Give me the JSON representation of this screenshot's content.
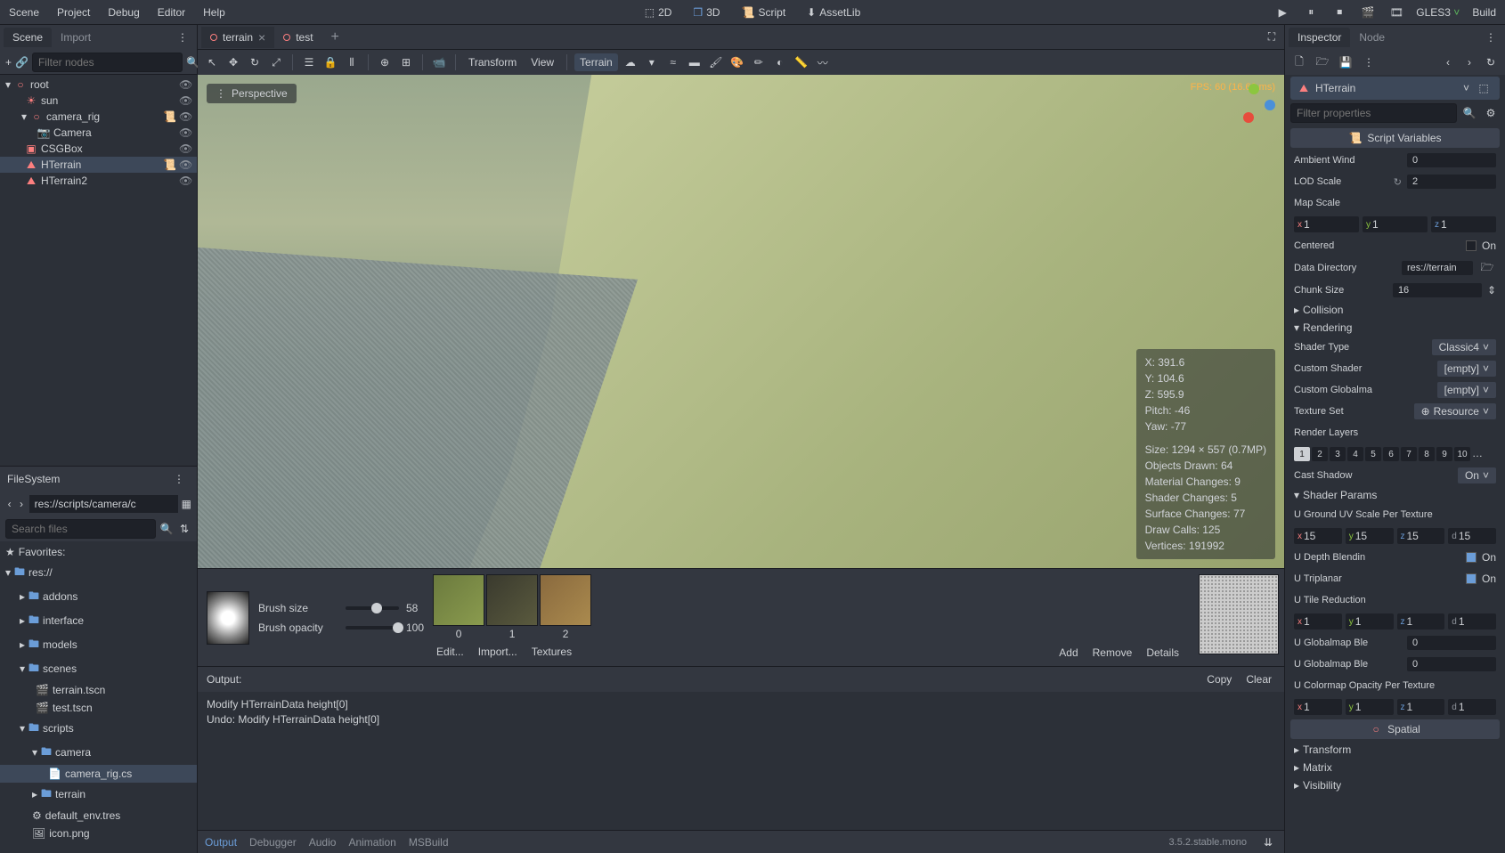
{
  "top_menu": {
    "items": [
      "Scene",
      "Project",
      "Debug",
      "Editor",
      "Help"
    ]
  },
  "top_center": {
    "d2": "2D",
    "d3": "3D",
    "script": "Script",
    "assetlib": "AssetLib"
  },
  "top_right": {
    "renderer": "GLES3",
    "build": "Build"
  },
  "scene_panel": {
    "tabs": {
      "scene": "Scene",
      "import": "Import"
    },
    "filter_placeholder": "Filter nodes",
    "nodes": {
      "root": "root",
      "sun": "sun",
      "camera_rig": "camera_rig",
      "camera": "Camera",
      "csgbox": "CSGBox",
      "hterrain": "HTerrain",
      "hterrain2": "HTerrain2"
    }
  },
  "filesystem": {
    "title": "FileSystem",
    "path": "res://scripts/camera/c",
    "search_placeholder": "Search files",
    "favorites": "Favorites:",
    "items": {
      "res": "res://",
      "addons": "addons",
      "interface": "interface",
      "models": "models",
      "scenes": "scenes",
      "terrain_tscn": "terrain.tscn",
      "test_tscn": "test.tscn",
      "scripts": "scripts",
      "camera": "camera",
      "camera_rig_cs": "camera_rig.cs",
      "terrain": "terrain",
      "default_env": "default_env.tres",
      "icon_png": "icon.png"
    }
  },
  "editor_tabs": {
    "terrain": "terrain",
    "test": "test"
  },
  "viewport_toolbar": {
    "transform": "Transform",
    "view": "View",
    "terrain": "Terrain"
  },
  "viewport": {
    "perspective": "Perspective",
    "fps": "FPS: 60 (16.66 ms)",
    "stats": {
      "x": "X: 391.6",
      "y": "Y: 104.6",
      "z": "Z: 595.9",
      "pitch": "Pitch: -46",
      "yaw": "Yaw: -77",
      "size": "Size: 1294 × 557 (0.7MP)",
      "objects": "Objects Drawn: 64",
      "material": "Material Changes: 9",
      "shader": "Shader Changes: 5",
      "surface": "Surface Changes: 77",
      "draw": "Draw Calls: 125",
      "vertices": "Vertices: 191992"
    }
  },
  "terrain_panel": {
    "brush_size_label": "Brush size",
    "brush_size": "58",
    "brush_opacity_label": "Brush opacity",
    "brush_opacity": "100",
    "tex0": "0",
    "tex1": "1",
    "tex2": "2",
    "edit": "Edit...",
    "import": "Import...",
    "textures": "Textures",
    "add": "Add",
    "remove": "Remove",
    "details": "Details"
  },
  "output": {
    "label": "Output:",
    "copy": "Copy",
    "clear": "Clear",
    "lines": [
      "Modify HTerrainData height[0]",
      "Undo: Modify HTerrainData height[0]"
    ]
  },
  "bottom_tabs": {
    "output": "Output",
    "debugger": "Debugger",
    "audio": "Audio",
    "animation": "Animation",
    "msbuild": "MSBuild"
  },
  "version": "3.5.2.stable.mono",
  "inspector": {
    "tabs": {
      "inspector": "Inspector",
      "node": "Node"
    },
    "selected": "HTerrain",
    "filter_placeholder": "Filter properties",
    "script_vars": "Script Variables",
    "props": {
      "ambient_wind": {
        "label": "Ambient Wind",
        "value": "0"
      },
      "lod_scale": {
        "label": "LOD Scale",
        "value": "2"
      },
      "map_scale": {
        "label": "Map Scale",
        "x": "1",
        "y": "1",
        "z": "1"
      },
      "centered": {
        "label": "Centered",
        "value": "On"
      },
      "data_dir": {
        "label": "Data Directory",
        "value": "res://terrain"
      },
      "chunk_size": {
        "label": "Chunk Size",
        "value": "16"
      },
      "collision": "Collision",
      "rendering": "Rendering",
      "shader_type": {
        "label": "Shader Type",
        "value": "Classic4"
      },
      "custom_shader": {
        "label": "Custom Shader",
        "value": "[empty]"
      },
      "custom_globalmap": {
        "label": "Custom Globalma",
        "value": "[empty]"
      },
      "texture_set": {
        "label": "Texture Set",
        "value": "Resource"
      },
      "render_layers": "Render Layers",
      "cast_shadow": {
        "label": "Cast Shadow",
        "value": "On"
      },
      "shader_params": "Shader Params",
      "ground_uv": {
        "label": "U Ground UV Scale Per Texture",
        "x": "15",
        "y": "15",
        "z": "15",
        "d": "15"
      },
      "depth_blend": {
        "label": "U Depth Blendin",
        "value": "On"
      },
      "triplanar": {
        "label": "U Triplanar",
        "value": "On"
      },
      "tile_reduction": {
        "label": "U Tile Reduction",
        "x": "1",
        "y": "1",
        "z": "1",
        "d": "1"
      },
      "globalmap_ble1": {
        "label": "U Globalmap Ble",
        "value": "0"
      },
      "globalmap_ble2": {
        "label": "U Globalmap Ble",
        "value": "0"
      },
      "colormap": {
        "label": "U Colormap Opacity Per Texture",
        "x": "1",
        "y": "1",
        "z": "1",
        "d": "1"
      },
      "spatial": "Spatial",
      "transform": "Transform",
      "matrix": "Matrix",
      "visibility": "Visibility"
    },
    "layers": [
      "1",
      "2",
      "3",
      "4",
      "5",
      "6",
      "7",
      "8",
      "9",
      "10"
    ]
  }
}
